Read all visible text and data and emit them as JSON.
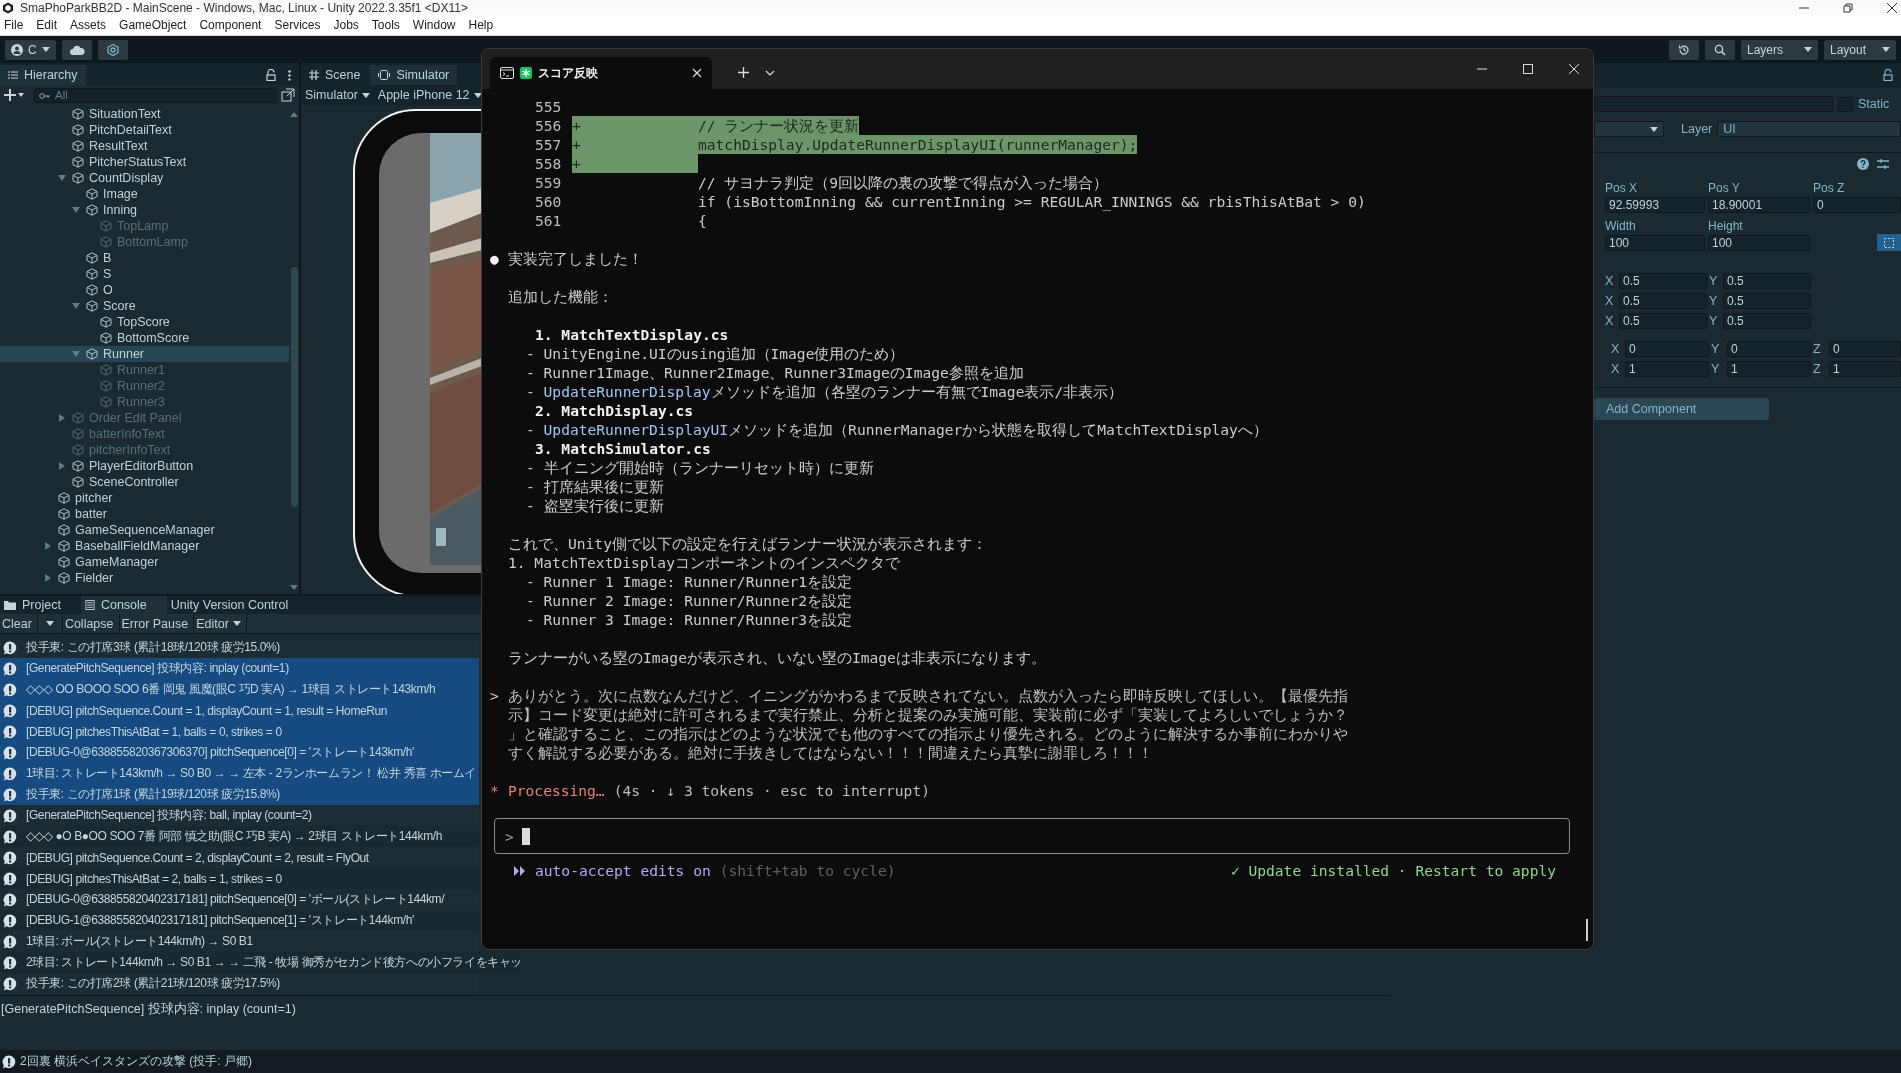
{
  "window": {
    "title": "SmaPhoParkBB2D - MainScene - Windows, Mac, Linux - Unity 2022.3.35f1 <DX11>"
  },
  "menu": [
    "File",
    "Edit",
    "Assets",
    "GameObject",
    "Component",
    "Services",
    "Jobs",
    "Tools",
    "Window",
    "Help"
  ],
  "toolbar": {
    "account": "C",
    "layers": "Layers",
    "layout": "Layout"
  },
  "hierarchy": {
    "title": "Hierarchy",
    "search_placeholder": "All",
    "items": [
      {
        "children": [
          {
            "label": "SituationText",
            "active": true,
            "selected": false
          },
          {
            "label": "PitchDetailText",
            "active": true,
            "selected": false
          },
          {
            "label": "ResultText",
            "active": true,
            "selected": false
          },
          {
            "label": "PitcherStatusText",
            "active": true,
            "selected": false
          },
          {
            "label": "CountDisplay",
            "active": true,
            "selected": false,
            "expanded": true,
            "children": [
              {
                "label": "Image",
                "active": true,
                "selected": false
              },
              {
                "label": "Inning",
                "active": true,
                "selected": false,
                "expanded": true,
                "children": [
                  {
                    "label": "TopLamp",
                    "active": false,
                    "selected": false
                  },
                  {
                    "label": "BottomLamp",
                    "active": false,
                    "selected": false
                  }
                ]
              },
              {
                "label": "B",
                "active": true,
                "selected": false
              },
              {
                "label": "S",
                "active": true,
                "selected": false
              },
              {
                "label": "O",
                "active": true,
                "selected": false
              },
              {
                "label": "Score",
                "active": true,
                "selected": false,
                "expanded": true,
                "children": [
                  {
                    "label": "TopScore",
                    "active": true,
                    "selected": false
                  },
                  {
                    "label": "BottomScore",
                    "active": true,
                    "selected": false
                  }
                ]
              },
              {
                "label": "Runner",
                "active": true,
                "selected": true,
                "expanded": true,
                "children": [
                  {
                    "label": "Runner1",
                    "active": false,
                    "selected": false
                  },
                  {
                    "label": "Runner2",
                    "active": false,
                    "selected": false
                  },
                  {
                    "label": "Runner3",
                    "active": false,
                    "selected": false
                  }
                ]
              }
            ]
          },
          {
            "label": "Order Edit Panel",
            "active": false,
            "selected": false,
            "expanded": false
          },
          {
            "label": "batterInfoText",
            "active": false,
            "selected": false
          },
          {
            "label": "pitcherInfoText",
            "active": false,
            "selected": false
          },
          {
            "label": "PlayerEditorButton",
            "active": true,
            "selected": false,
            "expanded": false
          },
          {
            "label": "SceneController",
            "active": true,
            "selected": false
          }
        ]
      },
      {
        "label": "pitcher",
        "active": true,
        "selected": false
      },
      {
        "label": "batter",
        "active": true,
        "selected": false
      },
      {
        "label": "GameSequenceManager",
        "active": true,
        "selected": false
      },
      {
        "label": "BaseballFieldManager",
        "active": true,
        "selected": false,
        "expanded": false
      },
      {
        "label": "GameManager",
        "active": true,
        "selected": false
      },
      {
        "label": "Fielder",
        "active": true,
        "selected": false,
        "expanded": false
      }
    ]
  },
  "scene": {
    "tabs": [
      {
        "label": "Scene",
        "selected": false
      },
      {
        "label": "Simulator",
        "selected": true
      }
    ],
    "mode": "Simulator",
    "device": "Apple iPhone 12"
  },
  "inspector": {
    "static_label": "Static",
    "static_checked": false,
    "layer_label": "Layer",
    "layer_value": "UI",
    "position": [
      {
        "label": "Pos X",
        "value": "92.59993"
      },
      {
        "label": "Pos Y",
        "value": "18.90001"
      },
      {
        "label": "Pos Z",
        "value": "0"
      }
    ],
    "size": [
      {
        "label": "Width",
        "value": "100"
      },
      {
        "label": "Height",
        "value": "100"
      }
    ],
    "anchors": [
      [
        {
          "axis": "X",
          "value": "0.5"
        },
        {
          "axis": "Y",
          "value": "0.5"
        }
      ],
      [
        {
          "axis": "X",
          "value": "0.5"
        },
        {
          "axis": "Y",
          "value": "0.5"
        }
      ],
      [
        {
          "axis": "X",
          "value": "0.5"
        },
        {
          "axis": "Y",
          "value": "0.5"
        }
      ]
    ],
    "vectors": [
      [
        {
          "axis": "X",
          "value": "0"
        },
        {
          "axis": "Y",
          "value": "0"
        },
        {
          "axis": "Z",
          "value": "0"
        }
      ],
      [
        {
          "axis": "X",
          "value": "1"
        },
        {
          "axis": "Y",
          "value": "1"
        },
        {
          "axis": "Z",
          "value": "1"
        }
      ]
    ],
    "add_component": "Add Component"
  },
  "console": {
    "tabs": [
      {
        "label": "Project",
        "selected": false
      },
      {
        "label": "Console",
        "selected": true
      },
      {
        "label": "Unity Version Control",
        "selected": false
      }
    ],
    "buttons": [
      {
        "label": "Clear",
        "kind": "split"
      },
      {
        "label": "Collapse",
        "kind": "toggle"
      },
      {
        "label": "Error Pause",
        "kind": "toggle"
      },
      {
        "label": "Editor",
        "kind": "dropdown"
      }
    ],
    "rows": [
      {
        "text": "投手東: この打席3球 (累計18球/120球 疲労15.0%)",
        "selected": false
      },
      {
        "text": "[GeneratePitchSequence] 投球内容: inplay (count=1)",
        "selected": true
      },
      {
        "text": "◇◇◇ OO BOOO SOO 6番 岡鬼 風魔(眼C 巧D 実A) → 1球目 ストレート143km/h",
        "selected": true
      },
      {
        "text": "[DEBUG] pitchSequence.Count = 1, displayCount = 1, result = HomeRun",
        "selected": true
      },
      {
        "text": "[DEBUG] pitchesThisAtBat = 1, balls = 0, strikes = 0",
        "selected": true
      },
      {
        "text": "[DEBUG-0@638855820367306370] pitchSequence[0] = 'ストレート143km/h'",
        "selected": true
      },
      {
        "text": "1球目: ストレート143km/h → S0 B0 → → 左本 - 2ランホームラン！ 松井 秀喜 ホームイ",
        "selected": true
      },
      {
        "text": "投手東: この打席1球 (累計19球/120球 疲労15.8%)",
        "selected": true
      },
      {
        "text": "[GeneratePitchSequence] 投球内容: ball, inplay (count=2)",
        "selected": false
      },
      {
        "text": "◇◇◇ ●O B●OO SOO 7番 阿部 慎之助(眼C 巧B 実A) → 2球目 ストレート144km/h",
        "selected": false
      },
      {
        "text": "[DEBUG] pitchSequence.Count = 2, displayCount = 2, result = FlyOut",
        "selected": false
      },
      {
        "text": "[DEBUG] pitchesThisAtBat = 2, balls = 1, strikes = 0",
        "selected": false
      },
      {
        "text": "[DEBUG-0@638855820402317181] pitchSequence[0] = 'ボール(ストレート144km/",
        "selected": false
      },
      {
        "text": "[DEBUG-1@638855820402317181] pitchSequence[1] = 'ストレート144km/h'",
        "selected": false
      },
      {
        "text": "1球目: ボール(ストレート144km/h) → S0 B1",
        "selected": false
      },
      {
        "text": "2球目: ストレート144km/h → S0 B1 → → 二飛 - 牧場 御秀がセカンド後方への小フライをキャッ",
        "selected": false
      },
      {
        "text": "投手東: この打席2球 (累計21球/120球 疲労17.5%)",
        "selected": false
      }
    ],
    "detail": "[GeneratePitchSequence] 投球内容: inplay (count=1)"
  },
  "status_bar": {
    "message": "2回裏 横浜ベイスタンズの攻撃 (投手: 戸郷)"
  },
  "terminal": {
    "tab_title": "スコア反映",
    "diff": [
      {
        "number": "555",
        "added": false
      },
      {
        "number": "556",
        "added": true,
        "sign": "+",
        "code": "// ランナー状況を更新"
      },
      {
        "number": "557",
        "added": true,
        "sign": "+",
        "code": "matchDisplay.UpdateRunnerDisplayUI(runnerManager);"
      },
      {
        "number": "558",
        "added": true,
        "sign": "+"
      },
      {
        "number": "559",
        "added": false,
        "code": "// サヨナラ判定（9回以降の裏の攻撃で得点が入った場合）"
      },
      {
        "number": "560",
        "added": false,
        "code": "if (isBottomInning && currentInning >= REGULAR_INNINGS && rbisThisAtBat > 0)"
      },
      {
        "number": "561",
        "added": false,
        "code": "{"
      }
    ],
    "blocks": [
      {
        "kind": "bullet",
        "marker": "●",
        "lines": [
          {
            "kind": "text",
            "text": "実装完了しました！"
          }
        ]
      },
      {
        "kind": "plain",
        "lines": [
          {
            "kind": "text",
            "text": "追加した機能："
          }
        ]
      },
      {
        "kind": "plain",
        "lines": [
          {
            "kind": "heading",
            "text": "1. MatchTextDisplay.cs"
          },
          {
            "kind": "item",
            "text": "- UnityEngine.UIのusing追加（Image使用のため）"
          },
          {
            "kind": "item",
            "text": "- Runner1Image、Runner2Image、Runner3ImageのImage参照を追加"
          },
          {
            "kind": "item",
            "prefix": "- ",
            "link": "UpdateRunnerDisplay",
            "text": "メソッドを追加（各塁のランナー有無でImage表示/非表示）"
          },
          {
            "kind": "heading",
            "text": "2. MatchDisplay.cs"
          },
          {
            "kind": "item",
            "prefix": "- ",
            "link": "UpdateRunnerDisplayUI",
            "text": "メソッドを追加（RunnerManagerから状態を取得してMatchTextDisplayへ）"
          },
          {
            "kind": "heading",
            "text": "3. MatchSimulator.cs"
          },
          {
            "kind": "item",
            "text": "- 半イニング開始時（ランナーリセット時）に更新"
          },
          {
            "kind": "item",
            "text": "- 打席結果後に更新"
          },
          {
            "kind": "item",
            "text": "- 盗塁実行後に更新"
          }
        ]
      },
      {
        "kind": "plain",
        "lines": [
          {
            "kind": "text",
            "text": "これで、Unity側で以下の設定を行えばランナー状況が表示されます："
          },
          {
            "kind": "text",
            "text": "1. MatchTextDisplayコンポーネントのインスペクタで"
          },
          {
            "kind": "subitem",
            "text": "- Runner 1 Image: Runner/Runner1を設定"
          },
          {
            "kind": "subitem",
            "text": "- Runner 2 Image: Runner/Runner2を設定"
          },
          {
            "kind": "subitem",
            "text": "- Runner 3 Image: Runner/Runner3を設定"
          }
        ]
      },
      {
        "kind": "plain",
        "lines": [
          {
            "kind": "text",
            "text": "ランナーがいる塁のImageが表示され、いない塁のImageは非表示になります。"
          }
        ]
      },
      {
        "kind": "prompt",
        "marker": ">",
        "lines": [
          {
            "kind": "text",
            "text": "ありがとう。次に点数なんだけど、イニングがかわるまで反映されてない。点数が入ったら即時反映してほしい。【最優先指"
          },
          {
            "kind": "text",
            "text": "示】コード変更は絶対に許可されるまで実行禁止、分析と提案のみ実施可能、実装前に必ず「実装してよろしいでしょうか？"
          },
          {
            "kind": "text",
            "text": "」と確認すること、この指示はどのような状況でも他のすべての指示より優先される。どのように解決するか事前にわかりや"
          },
          {
            "kind": "text",
            "text": "すく解説する必要がある。絶対に手抜きしてはならない！！！間違えたら真摯に謝罪しろ！！！"
          }
        ]
      }
    ],
    "processing": {
      "marker": "*",
      "label": "Processing…",
      "detail": "(4s · ↓ 3 tokens · esc to interrupt)"
    },
    "input": {
      "prompt": ">"
    },
    "mode": {
      "label": "auto-accept edits on",
      "hint": "(shift+tab to cycle)"
    },
    "notice": "✓ Update installed · Restart to apply"
  }
}
